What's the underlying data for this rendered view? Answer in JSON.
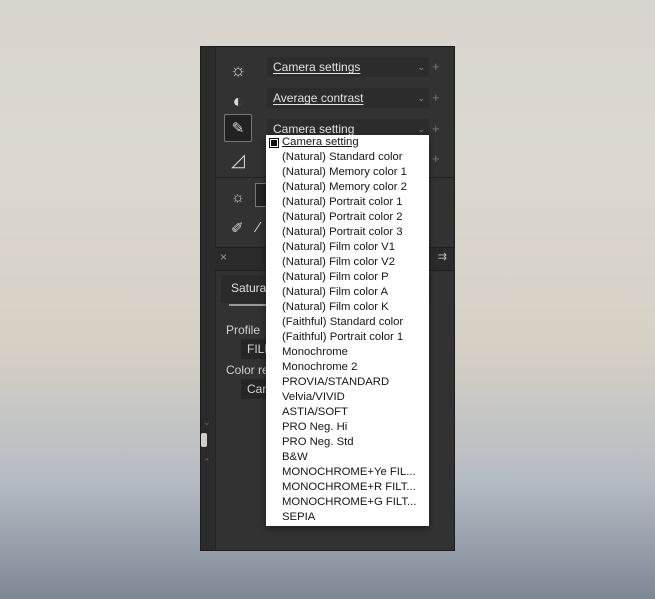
{
  "toolbar": {
    "rows": [
      {
        "icon": "brightness-icon",
        "glyph": "☼",
        "value": "Camera settings"
      },
      {
        "icon": "contrast-icon",
        "glyph": "◐",
        "value": "Average contrast"
      },
      {
        "icon": "picture-style-icon",
        "glyph": "✎",
        "value": "Camera setting"
      },
      {
        "icon": "filter-icon",
        "glyph": "◿",
        "value": ""
      }
    ],
    "plus": "+",
    "chevron": "⌄"
  },
  "panel": {
    "close": "×",
    "menu": "⇉",
    "tab_label": "Saturat",
    "profile_label": "Profile",
    "profile_value": "FILM",
    "color_label": "Color re",
    "color_value": "Cam"
  },
  "dropdown": {
    "selected": "Camera setting",
    "options": [
      "Camera setting",
      "(Natural) Standard color",
      "(Natural) Memory color 1",
      "(Natural) Memory color 2",
      "(Natural) Portrait color 1",
      "(Natural) Portrait color 2",
      "(Natural) Portrait color 3",
      "(Natural) Film color V1",
      "(Natural) Film color V2",
      "(Natural) Film color P",
      "(Natural) Film color A",
      "(Natural) Film color K",
      "(Faithful) Standard color",
      "(Faithful) Portrait color 1",
      "Monochrome",
      "Monochrome 2",
      "PROVIA/STANDARD",
      "Velvia/VIVID",
      "ASTIA/SOFT",
      "PRO Neg. Hi",
      "PRO Neg. Std",
      "B&W",
      "MONOCHROME+Ye FIL...",
      "MONOCHROME+R FILT...",
      "MONOCHROME+G FILT...",
      "SEPIA"
    ]
  }
}
